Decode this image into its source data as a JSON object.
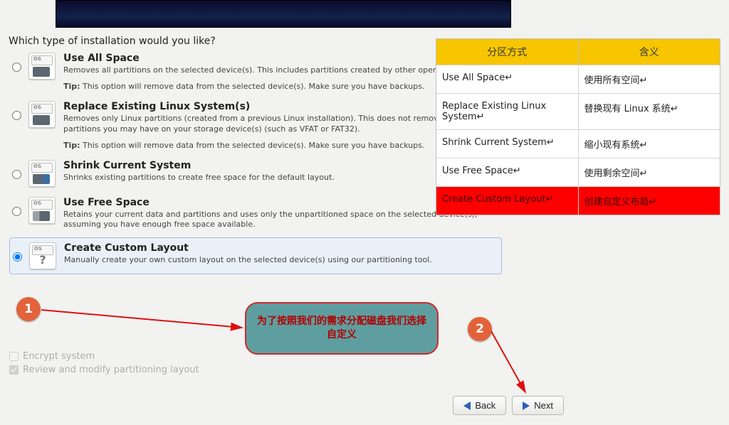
{
  "question": "Which type of installation would you like?",
  "options": [
    {
      "title": "Use All Space",
      "desc": "Removes all partitions on the selected device(s).  This includes partitions created by other operating systems.",
      "tip": "This option will remove data from the selected device(s).  Make sure you have backups."
    },
    {
      "title": "Replace Existing Linux System(s)",
      "desc": "Removes only Linux partitions (created from a previous Linux installation).  This does not remove other partitions you may have on your storage device(s) (such as VFAT or FAT32).",
      "tip": "This option will remove data from the selected device(s).  Make sure you have backups."
    },
    {
      "title": "Shrink Current System",
      "desc": "Shrinks existing partitions to create free space for the default layout."
    },
    {
      "title": "Use Free Space",
      "desc": "Retains your current data and partitions and uses only the unpartitioned space on the selected device(s), assuming you have enough free space available."
    },
    {
      "title": "Create Custom Layout",
      "desc": "Manually create your own custom layout on the selected device(s) using our partitioning tool."
    }
  ],
  "tip_label": "Tip:",
  "icon_os": "OS",
  "encrypt": "Encrypt system",
  "review": "Review and modify partitioning layout",
  "back": "Back",
  "next": "Next",
  "ref": {
    "h1": "分区方式",
    "h2": "含义",
    "rows": [
      {
        "a": "Use All Space↵",
        "b": "使用所有空间↵"
      },
      {
        "a": "Replace Existing Linux System↵",
        "b": "替换现有 Linux 系统↵"
      },
      {
        "a": "Shrink Current System↵",
        "b": "缩小现有系统↵"
      },
      {
        "a": "Use Free Space↵",
        "b": "使用剩余空间↵"
      },
      {
        "a": "Create Custom Layout↵",
        "b": "创建自定义布局↵"
      }
    ]
  },
  "badge1": "1",
  "badge2": "2",
  "callout": "为了按照我们的需求分配磁盘我们选择自定义"
}
